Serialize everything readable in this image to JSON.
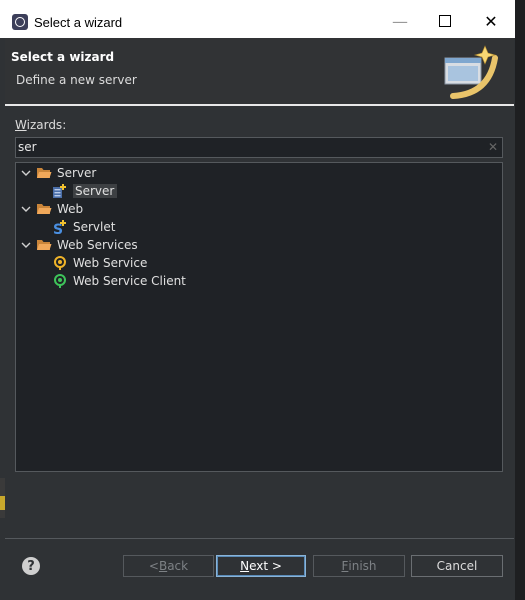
{
  "window": {
    "title": "Select a wizard",
    "minimize_glyph": "—",
    "close_glyph": "✕"
  },
  "header": {
    "title": "Select a wizard",
    "description": "Define a new server"
  },
  "wizards": {
    "label_prefix": "W",
    "label_rest": "izards:",
    "filter_value": "ser",
    "clear_glyph": "✕"
  },
  "tree": [
    {
      "label": "Server",
      "icon": "folder-open-icon",
      "expanded": true,
      "children": [
        {
          "label": "Server",
          "icon": "server-wizard-icon",
          "selected": true
        }
      ]
    },
    {
      "label": "Web",
      "icon": "folder-open-icon",
      "expanded": true,
      "children": [
        {
          "label": "Servlet",
          "icon": "servlet-icon"
        }
      ]
    },
    {
      "label": "Web Services",
      "icon": "folder-open-icon",
      "expanded": true,
      "children": [
        {
          "label": "Web Service",
          "icon": "web-service-icon"
        },
        {
          "label": "Web Service Client",
          "icon": "web-service-client-icon"
        }
      ]
    }
  ],
  "footer": {
    "help_glyph": "?",
    "back_prefix": "< ",
    "back_accel": "B",
    "back_rest": "ack",
    "next_accel": "N",
    "next_rest": "ext >",
    "finish_accel": "F",
    "finish_rest": "inish",
    "cancel_label": "Cancel"
  },
  "colors": {
    "folder": "#e8a24a",
    "accent_focus": "#8ab4d8",
    "background": "#2f3235"
  }
}
